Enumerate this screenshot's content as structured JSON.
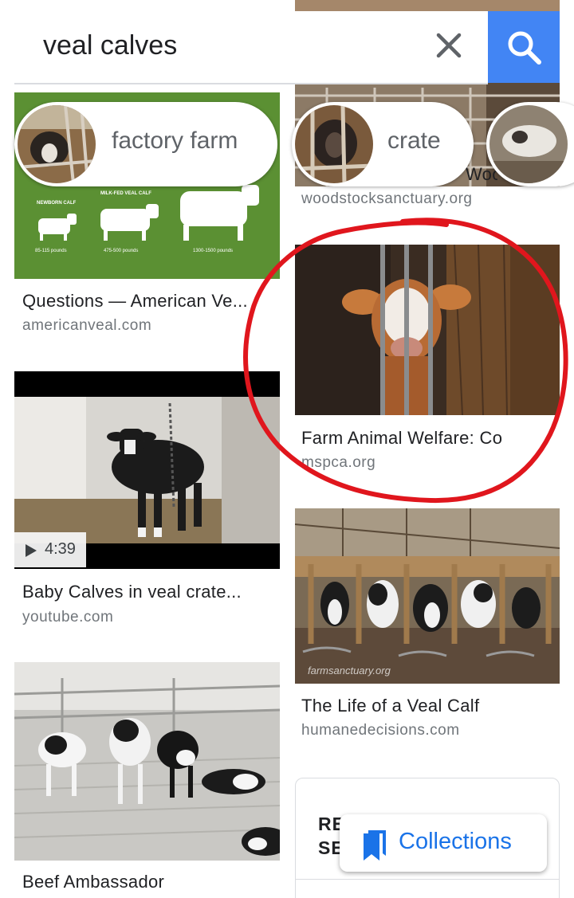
{
  "search": {
    "query": "veal calves"
  },
  "chips": [
    {
      "label": "factory farm"
    },
    {
      "label": "crate"
    }
  ],
  "results": [
    {
      "title": "Questions — American Ve...",
      "source": "americanveal.com"
    },
    {
      "title": "Baby Calves in veal crate...",
      "source": "youtube.com",
      "duration": "4:39"
    },
    {
      "title": "Beef Ambassador",
      "source": ""
    },
    {
      "title": "Woo",
      "source": "woodstocksanctuary.org"
    },
    {
      "title": "Farm Animal Welfare: Co",
      "source": "mspca.org"
    },
    {
      "title": "The Life of a Veal Calf",
      "source": "humanedecisions.com"
    }
  ],
  "infographic": {
    "labels": [
      "NEWBORN CALF",
      "MILK-FED VEAL CALF",
      "85-115 pounds",
      "475-500 pounds",
      "1300-1500 pounds"
    ]
  },
  "related": {
    "heading": "RELATED SE"
  },
  "collections": {
    "label": "Collections"
  },
  "watermark": "farmsanctuary.org",
  "colors": {
    "accent": "#4285f4",
    "link": "#1a73e8",
    "annotation": "#e0161d"
  }
}
